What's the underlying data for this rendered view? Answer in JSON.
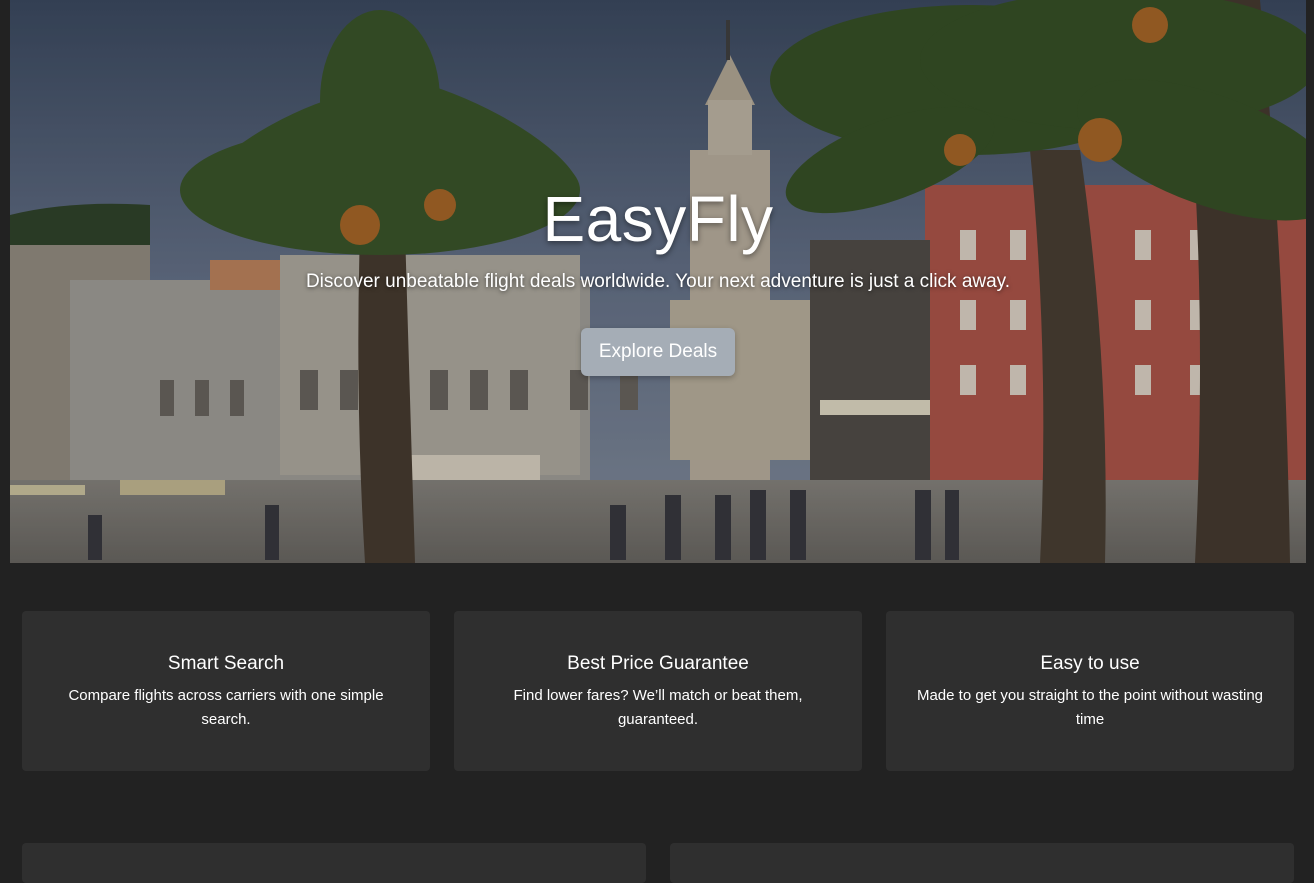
{
  "hero": {
    "title": "EasyFly",
    "subtitle": "Discover unbeatable flight deals worldwide. Your next adventure is just a click away.",
    "cta_label": "Explore Deals"
  },
  "features": [
    {
      "title": "Smart Search",
      "text": "Compare flights across carriers with one simple search."
    },
    {
      "title": "Best Price Guarantee",
      "text": "Find lower fares? We’ll match or beat them, guaranteed."
    },
    {
      "title": "Easy to use",
      "text": "Made to get you straight to the point without wasting time"
    }
  ],
  "colors": {
    "background": "#222222",
    "card": "#2f2f2f",
    "button": "#a5adb6"
  }
}
